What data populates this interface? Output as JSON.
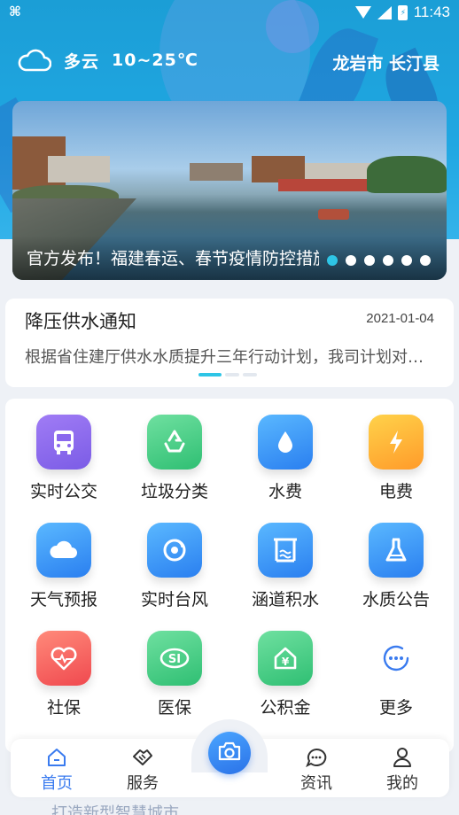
{
  "status_bar": {
    "time": "11:43",
    "battery_glyph": "⚡"
  },
  "weather": {
    "condition": "多云",
    "temperature": "10~25℃",
    "location": "龙岩市 长汀县"
  },
  "banner": {
    "caption": "官方发布！福建春运、春节疫情防控措施",
    "slide_count": 6,
    "active_index": 0
  },
  "notice": {
    "title": "降压供水通知",
    "date": "2021-01-04",
    "body": "根据省住建厅供水水质提升三年行动计划，我司计划对供水管网进行降压"
  },
  "services": [
    {
      "label": "实时公交",
      "icon": "bus-icon",
      "color": "purple"
    },
    {
      "label": "垃圾分类",
      "icon": "recycle-icon",
      "color": "green"
    },
    {
      "label": "水费",
      "icon": "water-drop-icon",
      "color": "blue"
    },
    {
      "label": "电费",
      "icon": "lightning-icon",
      "color": "orange"
    },
    {
      "label": "天气预报",
      "icon": "cloud-icon",
      "color": "blue"
    },
    {
      "label": "实时台风",
      "icon": "typhoon-icon",
      "color": "blue"
    },
    {
      "label": "涵道积水",
      "icon": "culvert-water-icon",
      "color": "blue"
    },
    {
      "label": "水质公告",
      "icon": "flask-icon",
      "color": "blue"
    },
    {
      "label": "社保",
      "icon": "heart-pulse-icon",
      "color": "red"
    },
    {
      "label": "医保",
      "icon": "medical-insurance-icon",
      "color": "green"
    },
    {
      "label": "公积金",
      "icon": "housing-fund-icon",
      "color": "green"
    },
    {
      "label": "更多",
      "icon": "more-icon",
      "color": "white"
    }
  ],
  "bottom_text": "打造新型智慧城市",
  "nav": {
    "items": [
      {
        "label": "首页",
        "icon": "home-icon",
        "active": true
      },
      {
        "label": "服务",
        "icon": "handshake-icon",
        "active": false
      },
      {
        "label": "资讯",
        "icon": "chat-icon",
        "active": false
      },
      {
        "label": "我的",
        "icon": "user-icon",
        "active": false
      }
    ],
    "camera_icon": "camera-icon"
  }
}
